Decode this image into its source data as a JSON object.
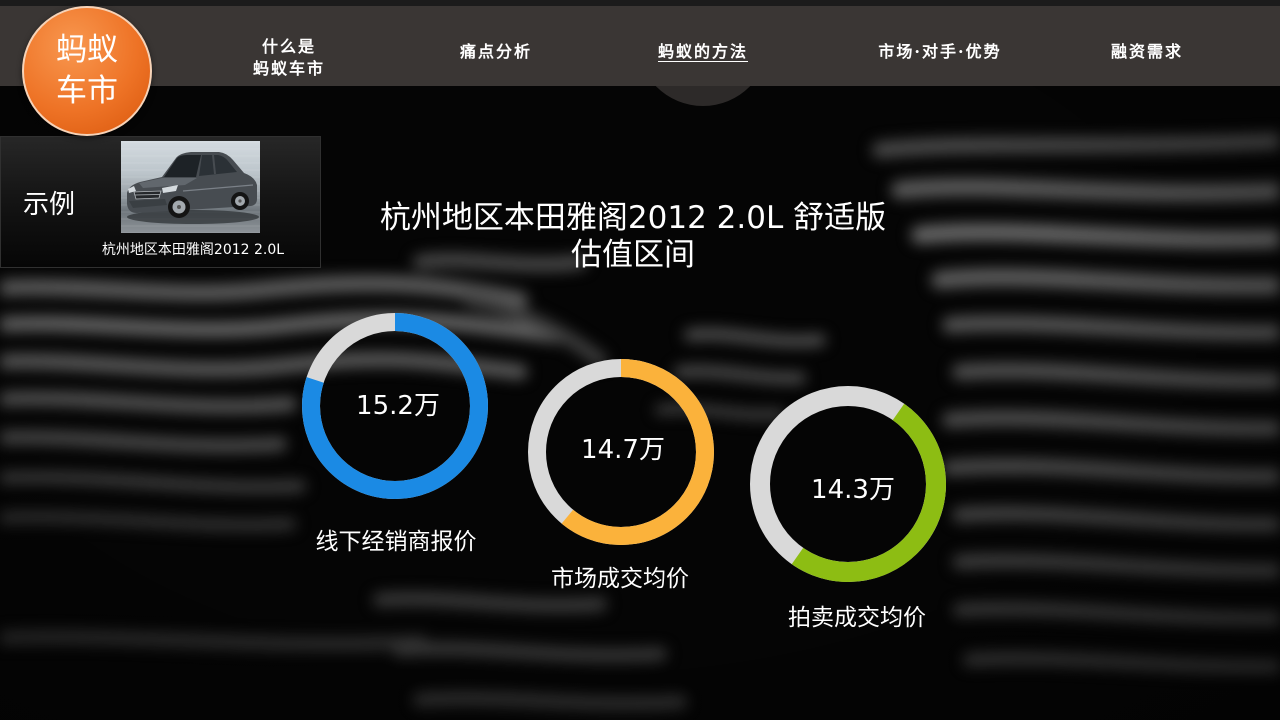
{
  "logo": {
    "line1": "蚂蚁",
    "line2": "车市"
  },
  "nav": {
    "items": [
      {
        "line1": "什么是",
        "line2": "蚂蚁车市",
        "active": false
      },
      {
        "label": "痛点分析",
        "active": false
      },
      {
        "label": "蚂蚁的方法",
        "active": true
      },
      {
        "label": "市场·对手·优势",
        "active": false
      },
      {
        "label": "融资需求",
        "active": false
      }
    ]
  },
  "example": {
    "label": "示例",
    "caption": "杭州地区本田雅阁2012 2.0L"
  },
  "heading": {
    "line1": "杭州地区本田雅阁2012 2.0L 舒适版",
    "line2": "估值区间"
  },
  "colors": {
    "nav_bar": "#3a3634",
    "logo_orange": "#ee7326",
    "nav_indicator": "#2d2a29"
  },
  "chart_data": {
    "type": "pie",
    "variant": "donut",
    "unit": "万",
    "track_color": "#d9d9d9",
    "series": [
      {
        "name": "线下经销商报价",
        "value": 15.2,
        "fill_fraction": 0.8,
        "color": "#1b8ae4"
      },
      {
        "name": "市场成交均价",
        "value": 14.7,
        "fill_fraction": 0.61,
        "color": "#fbb23b"
      },
      {
        "name": "拍卖成交均价",
        "value": 14.3,
        "fill_fraction": 0.5,
        "color": "#8dbd13"
      }
    ]
  }
}
